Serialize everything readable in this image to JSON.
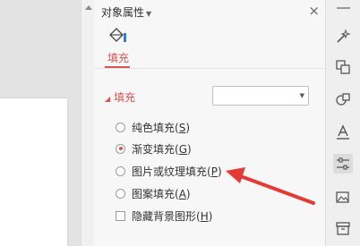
{
  "panel": {
    "title": "对象属性",
    "close_glyph": "×",
    "tab": {
      "label": "填充",
      "icon": "paint-bucket-icon"
    },
    "section": {
      "title": "填充",
      "dropdown_value": ""
    },
    "options": [
      {
        "text": "纯色填充(",
        "key": "S",
        "checked": false
      },
      {
        "text": "渐变填充(",
        "key": "G",
        "checked": true
      },
      {
        "text": "图片或纹理填充(",
        "key": "P",
        "checked": false
      },
      {
        "text": "图案填充(",
        "key": "A",
        "checked": false
      }
    ],
    "hide_bg": {
      "text": "隐藏背景图形(",
      "key": "H",
      "checked": false
    },
    "close_paren": ")"
  },
  "rail": {
    "icons": [
      "magic-wand-icon",
      "transform-icon",
      "shapes-icon",
      "text-style-icon",
      "settings-sliders-icon",
      "image-icon",
      "archive-icon"
    ],
    "active_index": 4
  },
  "colors": {
    "accent": "#d9534f",
    "arrow": "#e53935"
  }
}
